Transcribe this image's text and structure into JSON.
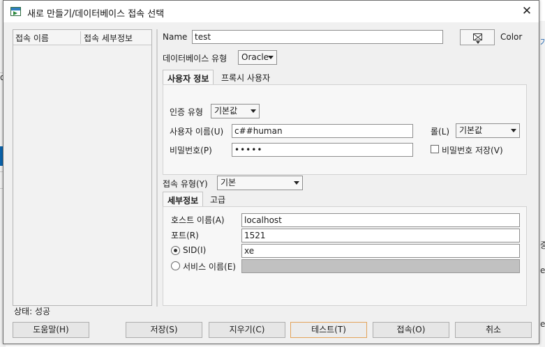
{
  "window": {
    "title": "새로 만들기/데이터베이스 접속 선택",
    "close_label": "✕"
  },
  "conn_list": {
    "columns": [
      "접속 이름",
      "접속 세부정보"
    ]
  },
  "status": "상태: 성공",
  "form": {
    "name_label": "Name",
    "name_value": "test",
    "color_label": "Color",
    "db_type_label": "데이터베이스 유형",
    "db_type_value": "Oracle",
    "tabs": [
      "사용자 정보",
      "프록시 사용자"
    ],
    "auth_type_label": "인증 유형",
    "auth_type_value": "기본값",
    "username_label": "사용자 이름(U)",
    "username_value": "c##human",
    "role_label": "롤(L)",
    "role_value": "기본값",
    "password_label": "비밀번호(P)",
    "password_value": "•••••",
    "save_password_label": "비밀번호 저장(V)",
    "conn_type_label": "접속 유형(Y)",
    "conn_type_value": "기본",
    "detail_tabs": [
      "세부정보",
      "고급"
    ],
    "host_label": "호스트 이름(A)",
    "host_value": "localhost",
    "port_label": "포트(R)",
    "port_value": "1521",
    "sid_label": "SID(I)",
    "sid_value": "xe",
    "service_label": "서비스 이름(E)",
    "service_value": ""
  },
  "buttons": {
    "help": "도움말(H)",
    "save": "저장(S)",
    "clear": "지우기(C)",
    "test": "테스트(T)",
    "connect": "접속(O)",
    "cancel": "취소"
  },
  "background": {
    "left_fragment": "ol",
    "right_fragments": [
      "가",
      "중",
      "ev",
      "e"
    ]
  },
  "colors": {
    "accent": "#0a64ad",
    "focus_border": "#e2a35a"
  }
}
